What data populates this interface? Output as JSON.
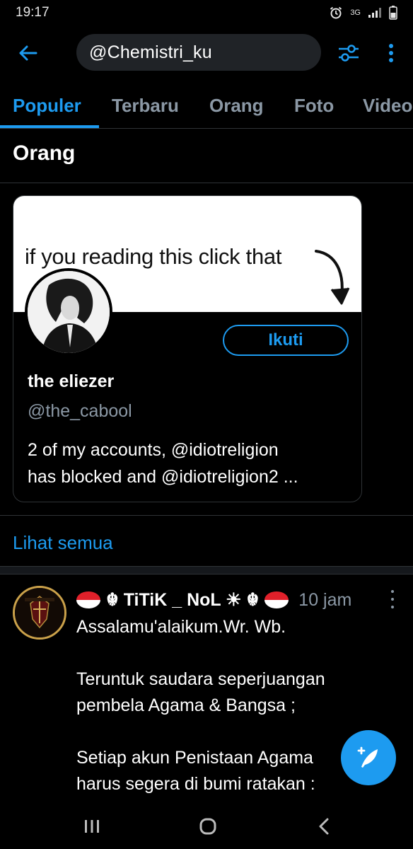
{
  "status_bar": {
    "time": "19:17",
    "network": "3G",
    "icons": [
      "alarm-icon",
      "signal-icon",
      "battery-icon"
    ]
  },
  "top_bar": {
    "search_value": "@Chemistri_ku",
    "icons": [
      "back-arrow-icon",
      "filter-sliders-icon",
      "more-vertical-icon"
    ]
  },
  "tabs": [
    {
      "label": "Populer",
      "active": true
    },
    {
      "label": "Terbaru",
      "active": false
    },
    {
      "label": "Orang",
      "active": false
    },
    {
      "label": "Foto",
      "active": false
    },
    {
      "label": "Video",
      "active": false
    }
  ],
  "people_section": {
    "title": "Orang",
    "card": {
      "banner_text": "if you reading this click that",
      "follow_label": "Ikuti",
      "name": "the eliezer",
      "handle": "@the_cabool",
      "bio_line1": "2 of my accounts, @idiotreligion",
      "bio_line2": "has blocked and @idiotreligion2 ..."
    },
    "see_all": "Lihat semua"
  },
  "tweet": {
    "name": "☬ TiTiK _ NoL ☀ ☬",
    "time": "10 jam",
    "lines": [
      "Assalamu'alaikum.Wr. Wb.",
      "",
      "Teruntuk saudara seperjuangan",
      "pembela Agama & Bangsa ;",
      "",
      "Setiap akun Penistaan Agama",
      "harus segera di bumi ratakan :"
    ]
  },
  "colors": {
    "accent": "#1d9bf0",
    "background": "#000000",
    "secondary_text": "#8b98a5",
    "flag_red": "#e0202a"
  }
}
